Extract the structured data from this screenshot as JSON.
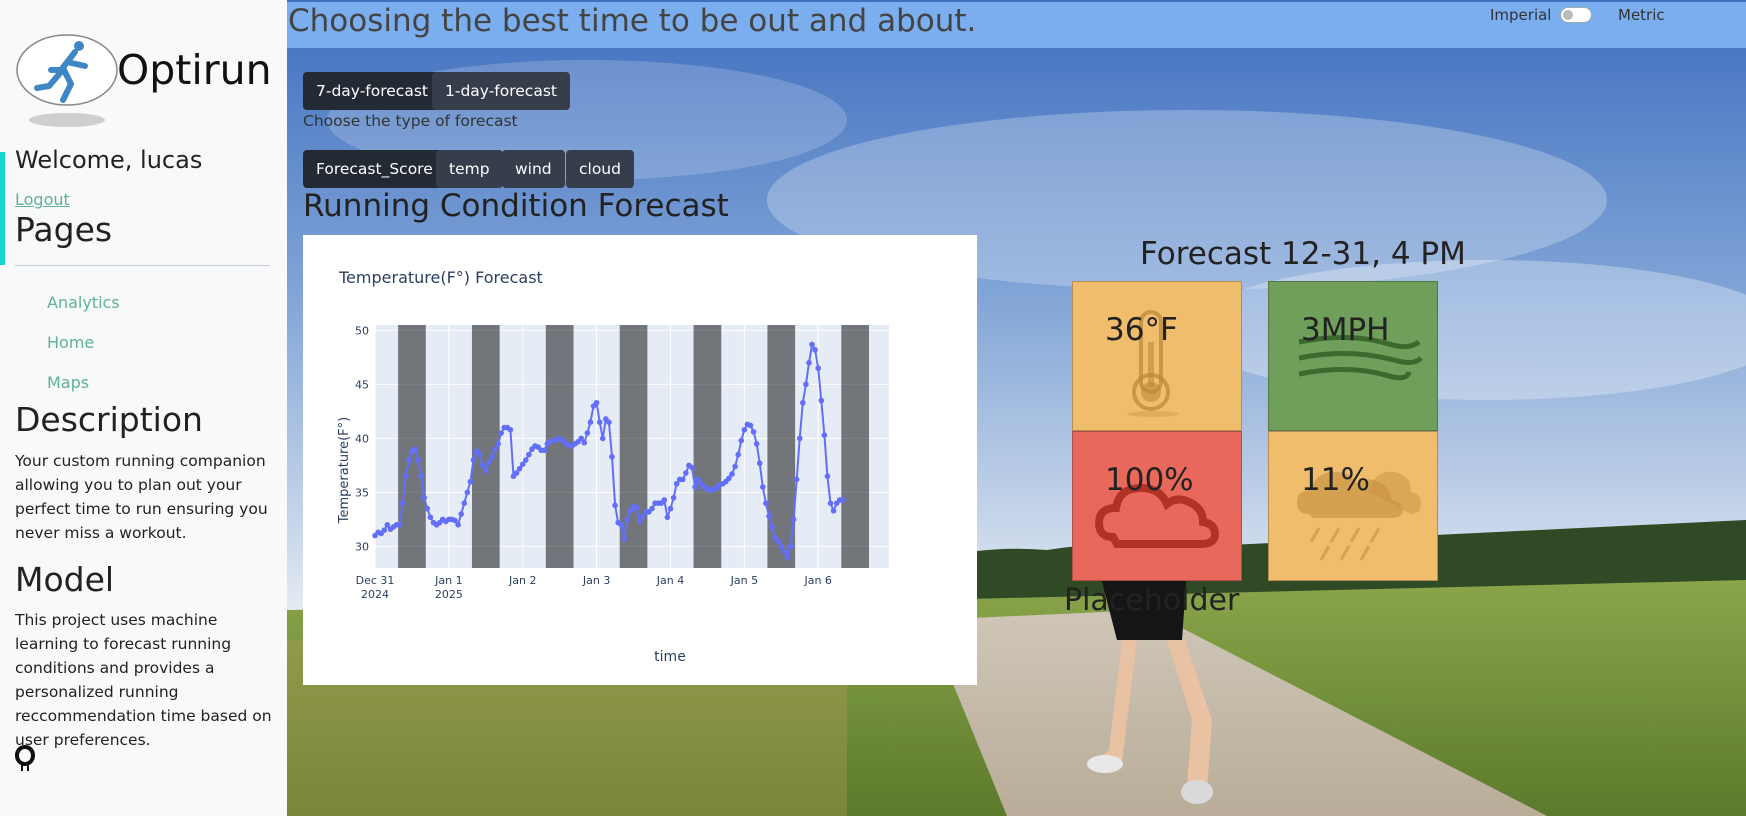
{
  "app": {
    "title": "Optirun"
  },
  "sidebar": {
    "welcome": "Welcome, lucas",
    "logout_label": "Logout",
    "pages_heading": "Pages",
    "nav_items": [
      {
        "label": "Analytics"
      },
      {
        "label": "Home"
      },
      {
        "label": "Maps"
      }
    ],
    "description_heading": "Description",
    "description_text": "Your custom running companion allowing you to plan out your perfect time to run ensuring you never miss a workout.",
    "model_heading": "Model",
    "model_text": "This project uses machine learning to forecast running conditions and provides a personalized running reccommendation time based on user preferences.",
    "github_icon": "github-icon"
  },
  "header": {
    "tagline": "Choosing the best time to be out and about.",
    "units": {
      "left_label": "Imperial",
      "right_label": "Metric",
      "metric_on": false
    }
  },
  "forecast_type": {
    "buttons": [
      {
        "label": "7-day-forecast",
        "active": true
      },
      {
        "label": "1-day-forecast",
        "active": false
      }
    ],
    "hint": "Choose the type of forecast"
  },
  "metric_tabs": [
    {
      "label": "Forecast_Score",
      "active": true
    },
    {
      "label": "temp",
      "active": false
    },
    {
      "label": "wind",
      "active": false
    },
    {
      "label": "cloud",
      "active": false
    }
  ],
  "section_heading": "Running Condition Forecast",
  "chart": {
    "title": "Temperature(F°) Forecast",
    "xlabel": "time",
    "ylabel": "Temperature(F°)"
  },
  "chart_data": {
    "type": "line",
    "title": "Temperature(F°) Forecast",
    "xlabel": "time",
    "ylabel": "Temperature(F°)",
    "ylim": [
      28,
      50.5
    ],
    "yticks": [
      30,
      35,
      40,
      45,
      50
    ],
    "x_tick_labels": [
      {
        "hour": 0,
        "line1": "Dec 31",
        "line2": "2024"
      },
      {
        "hour": 24,
        "line1": "Jan 1",
        "line2": "2025"
      },
      {
        "hour": 48,
        "line1": "Jan 2",
        "line2": ""
      },
      {
        "hour": 72,
        "line1": "Jan 3",
        "line2": ""
      },
      {
        "hour": 96,
        "line1": "Jan 4",
        "line2": ""
      },
      {
        "hour": 120,
        "line1": "Jan 5",
        "line2": ""
      },
      {
        "hour": 144,
        "line1": "Jan 6",
        "line2": ""
      }
    ],
    "x_unit": "hours since Dec 31 2024 00:00",
    "xlim": [
      0,
      167
    ],
    "night_bands": [
      [
        7.5,
        16.5
      ],
      [
        31.5,
        40.5
      ],
      [
        55.5,
        64.5
      ],
      [
        79.5,
        88.5
      ],
      [
        103.5,
        112.5
      ],
      [
        127.5,
        136.5
      ],
      [
        151.5,
        160.5
      ]
    ],
    "series": [
      {
        "color": "#636efa",
        "points": [
          [
            0,
            31
          ],
          [
            1,
            31.3
          ],
          [
            2,
            31.2
          ],
          [
            3,
            31.5
          ],
          [
            4,
            32
          ],
          [
            5,
            31.6
          ],
          [
            6,
            31.8
          ],
          [
            7,
            32
          ],
          [
            8,
            32
          ],
          [
            9,
            34
          ],
          [
            10,
            36.5
          ],
          [
            11,
            38
          ],
          [
            12,
            38.8
          ],
          [
            13,
            39
          ],
          [
            14,
            38
          ],
          [
            15,
            36.5
          ],
          [
            16,
            34.5
          ],
          [
            17,
            33.5
          ],
          [
            18,
            32.7
          ],
          [
            19,
            32.2
          ],
          [
            20,
            32
          ],
          [
            21,
            32.2
          ],
          [
            22,
            32.5
          ],
          [
            23,
            32.3
          ],
          [
            24,
            32.5
          ],
          [
            25,
            32.5
          ],
          [
            26,
            32.4
          ],
          [
            27,
            32
          ],
          [
            28,
            33
          ],
          [
            29,
            34
          ],
          [
            30,
            35
          ],
          [
            31,
            36
          ],
          [
            32,
            38
          ],
          [
            33,
            38.8
          ],
          [
            34,
            38.5
          ],
          [
            35,
            37.5
          ],
          [
            36,
            37
          ],
          [
            37,
            37.8
          ],
          [
            38,
            38.3
          ],
          [
            39,
            39
          ],
          [
            40,
            39.5
          ],
          [
            41,
            40.5
          ],
          [
            42,
            41
          ],
          [
            43,
            41
          ],
          [
            44,
            40.8
          ],
          [
            45,
            36.5
          ],
          [
            46,
            36.8
          ],
          [
            47,
            37.2
          ],
          [
            48,
            37.6
          ],
          [
            49,
            38
          ],
          [
            50,
            38.5
          ],
          [
            51,
            39
          ],
          [
            52,
            39.3
          ],
          [
            53,
            39.2
          ],
          [
            54,
            38.9
          ],
          [
            55,
            38.9
          ],
          [
            56,
            39.5
          ],
          [
            57,
            39.7
          ],
          [
            58,
            39.8
          ],
          [
            59,
            39.9
          ],
          [
            60,
            40
          ],
          [
            61,
            39.8
          ],
          [
            62,
            39.5
          ],
          [
            63,
            39.4
          ],
          [
            64,
            39.3
          ],
          [
            65,
            39.5
          ],
          [
            66,
            39.7
          ],
          [
            67,
            40
          ],
          [
            68,
            39.6
          ],
          [
            69,
            40.5
          ],
          [
            70,
            41.5
          ],
          [
            71,
            43
          ],
          [
            72,
            43.3
          ],
          [
            73,
            41.5
          ],
          [
            74,
            40
          ],
          [
            75,
            41.8
          ],
          [
            76,
            41.5
          ],
          [
            77,
            38.3
          ],
          [
            78,
            33.8
          ],
          [
            79,
            32.2
          ],
          [
            80,
            32
          ],
          [
            81,
            30.7
          ],
          [
            82,
            32.5
          ],
          [
            83,
            33.3
          ],
          [
            84,
            33.7
          ],
          [
            85,
            33.6
          ],
          [
            86,
            32.3
          ],
          [
            87,
            32.8
          ],
          [
            88,
            33.2
          ],
          [
            89,
            33.2
          ],
          [
            90,
            33.5
          ],
          [
            91,
            34
          ],
          [
            92,
            34
          ],
          [
            93,
            34
          ],
          [
            94,
            34.3
          ],
          [
            95,
            32.7
          ],
          [
            96,
            33.5
          ],
          [
            97,
            34.5
          ],
          [
            98,
            35.8
          ],
          [
            99,
            36.2
          ],
          [
            100,
            36.2
          ],
          [
            101,
            36.8
          ],
          [
            102,
            37.5
          ],
          [
            103,
            37.3
          ],
          [
            104,
            35.5
          ],
          [
            105,
            36.2
          ],
          [
            106,
            35.8
          ],
          [
            107,
            35.5
          ],
          [
            108,
            35.3
          ],
          [
            109,
            35.2
          ],
          [
            110,
            35.3
          ],
          [
            111,
            35.4
          ],
          [
            112,
            35.7
          ],
          [
            113,
            35.8
          ],
          [
            114,
            36
          ],
          [
            115,
            36.3
          ],
          [
            116,
            36.7
          ],
          [
            117,
            37.4
          ],
          [
            118,
            38.5
          ],
          [
            119,
            39.8
          ],
          [
            120,
            40.8
          ],
          [
            121,
            41.3
          ],
          [
            122,
            41.2
          ],
          [
            123,
            40.6
          ],
          [
            124,
            39.5
          ],
          [
            125,
            37.7
          ],
          [
            126,
            35.5
          ],
          [
            127,
            34
          ],
          [
            128,
            32.8
          ],
          [
            129,
            31.8
          ],
          [
            130,
            30.8
          ],
          [
            131,
            30.5
          ],
          [
            132,
            30
          ],
          [
            133,
            29.5
          ],
          [
            134,
            29
          ],
          [
            135,
            30
          ],
          [
            136,
            32.5
          ],
          [
            137,
            36.2
          ],
          [
            138,
            40
          ],
          [
            139,
            43.3
          ],
          [
            140,
            45
          ],
          [
            141,
            47
          ],
          [
            142,
            48.7
          ],
          [
            143,
            48.2
          ],
          [
            144,
            46.5
          ],
          [
            145,
            43.5
          ],
          [
            146,
            40.3
          ],
          [
            147,
            36.5
          ],
          [
            148,
            34
          ],
          [
            149,
            33.3
          ],
          [
            150,
            34
          ],
          [
            151,
            34.3
          ],
          [
            152,
            34.3
          ]
        ]
      }
    ]
  },
  "current_forecast": {
    "heading": "Forecast 12-31, 4 PM",
    "tiles": [
      {
        "value": "36°F",
        "icon": "thermometer-icon",
        "bg": "#efbd6c"
      },
      {
        "value": "3MPH",
        "icon": "wind-icon",
        "bg": "#6f9f5b"
      },
      {
        "value": "100%",
        "icon": "cloud-icon",
        "bg": "#e8685b"
      },
      {
        "value": "11%",
        "icon": "rain-cloud-icon",
        "bg": "#efbd6c"
      }
    ]
  },
  "placeholder_text": "Placeholder",
  "colors": {
    "topbar": "#7aaeee",
    "button": "#353e4a",
    "nav_link": "#5fb38f",
    "sidebar_accent": "#17d6d0"
  }
}
